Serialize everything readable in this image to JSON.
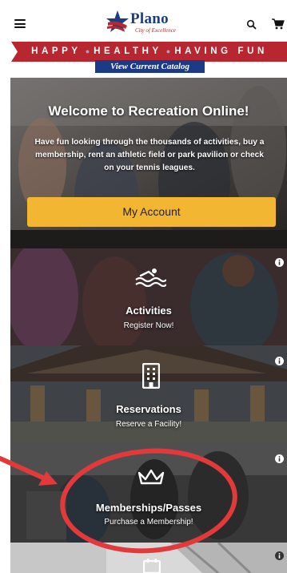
{
  "header": {
    "logo_name": "Plano",
    "logo_tagline": "City of Excellence"
  },
  "banner": {
    "word1": "HAPPY",
    "word2": "HEALTHY",
    "word3": "HAVING FUN",
    "catalog_label": "View Current Catalog",
    "color": "#b8262f"
  },
  "hero": {
    "title": "Welcome to Recreation Online!",
    "description": "Have fun looking through the thousands of activities, buy a membership, rent an athletic field or park pavilion or check on your tennis leagues.",
    "account_button": "My Account",
    "button_color": "#f2b632"
  },
  "tiles": [
    {
      "label": "Activities",
      "sub": "Register Now!",
      "icon": "swim-icon"
    },
    {
      "label": "Reservations",
      "sub": "Reserve a Facility!",
      "icon": "building-icon"
    },
    {
      "label": "Memberships/Passes",
      "sub": "Purchase a Membership!",
      "icon": "crown-icon"
    },
    {
      "label": "",
      "sub": "",
      "icon": "calendar-icon"
    }
  ],
  "annotation_color": "#e23a3a"
}
